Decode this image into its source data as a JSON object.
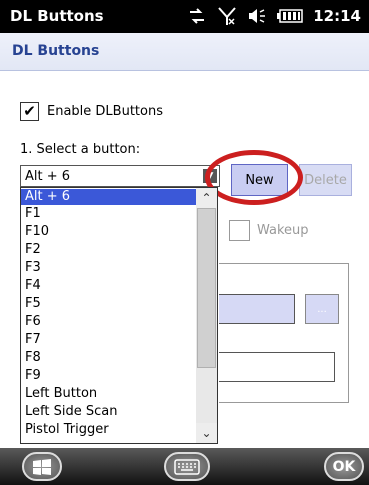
{
  "status_bar": {
    "app_title": "DL Buttons",
    "icons": [
      "connectivity-icon",
      "no-signal-icon",
      "volume-icon",
      "battery-icon"
    ],
    "time": "12:14"
  },
  "window": {
    "title": "DL Buttons"
  },
  "enable_checkbox": {
    "label": "Enable DLButtons",
    "checked": true,
    "check_glyph": "✔"
  },
  "select_label": "1. Select a button:",
  "button_combo": {
    "selected": "Alt + 6",
    "options": [
      "Alt + 6",
      "F1",
      "F10",
      "F2",
      "F3",
      "F4",
      "F5",
      "F6",
      "F7",
      "F8",
      "F9",
      "Left Button",
      "Left Side Scan",
      "Pistol Trigger"
    ]
  },
  "actions": {
    "new_label": "New",
    "delete_label": "Delete"
  },
  "wakeup": {
    "label": "Wakeup",
    "checked": false
  },
  "ellipsis_label": "...",
  "taskbar": {
    "ok_label": "OK"
  },
  "colors": {
    "accent": "#3b58d8",
    "title_text": "#274392",
    "highlight_ring": "#cc1f1f",
    "button_fill": "#c9cdf2"
  }
}
